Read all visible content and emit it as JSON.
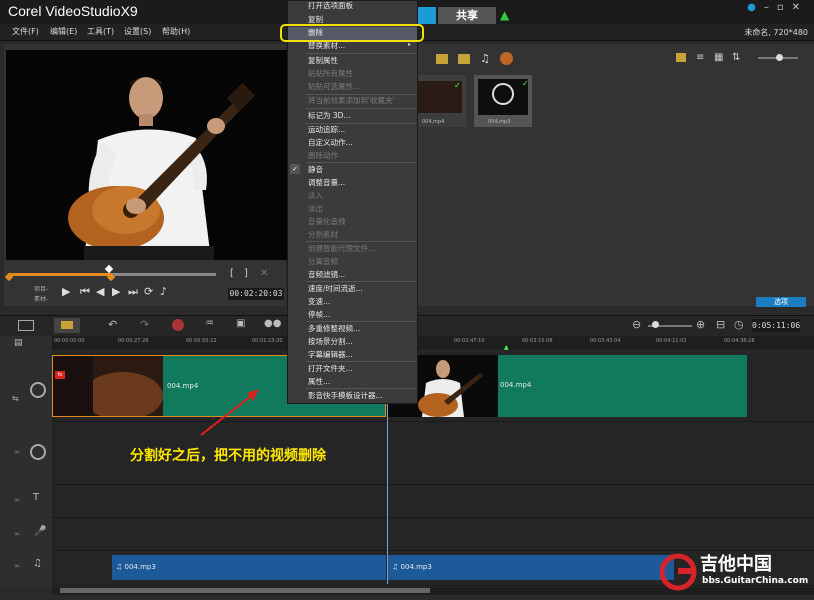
{
  "app": {
    "logo": "Corel VideoStudioX9",
    "share_tab": "共享",
    "project_info": "未命名, 720*480"
  },
  "menubar": {
    "items": [
      "文件(F)",
      "编辑(E)",
      "工具(T)",
      "设置(S)",
      "帮助(H)"
    ]
  },
  "preview": {
    "timecode": "00:02:20:03",
    "label_project": "项目-",
    "label_clip": "素材-"
  },
  "library": {
    "thumb1_label": "004.mp4",
    "thumb2_label": "004.mp3",
    "options_label": "选项"
  },
  "timeline": {
    "timecode": "0:05:11:06",
    "ruler_ticks": [
      "00:00:00:00",
      "00:00:27:26",
      "00:00:55:22",
      "00:01:23:20",
      "00:02:47:10",
      "00:03:15:08",
      "00:03:43:04",
      "00:04:11:02",
      "00:04:38:28"
    ],
    "video_clip1": "004.mp4",
    "video_clip2": "004.mp4",
    "audio_clip1": "004.mp3",
    "audio_clip2": "004.mp3"
  },
  "context_menu": {
    "items": [
      {
        "label": "打开选项面板",
        "disabled": false
      },
      {
        "label": "复制",
        "disabled": false
      },
      {
        "label": "删除",
        "disabled": false
      },
      {
        "label": "替换素材...",
        "disabled": false
      },
      {
        "label": "复制属性",
        "disabled": false
      },
      {
        "label": "粘贴所有属性",
        "disabled": true
      },
      {
        "label": "粘贴可选属性...",
        "disabled": true
      },
      {
        "label": "将当前效果添加到'收藏夹'",
        "disabled": true
      },
      {
        "label": "标记为 3D...",
        "disabled": false
      },
      {
        "label": "运动追踪...",
        "disabled": false
      },
      {
        "label": "自定义动作...",
        "disabled": false
      },
      {
        "label": "删除动作",
        "disabled": true
      },
      {
        "label": "静音",
        "disabled": false
      },
      {
        "label": "调整音量...",
        "disabled": false
      },
      {
        "label": "淡入",
        "disabled": true
      },
      {
        "label": "淡出",
        "disabled": true
      },
      {
        "label": "音量化音频",
        "disabled": true
      },
      {
        "label": "分割素材",
        "disabled": true
      },
      {
        "label": "创建智能代理文件...",
        "disabled": true
      },
      {
        "label": "分离音频",
        "disabled": true
      },
      {
        "label": "音频滤镜...",
        "disabled": false
      },
      {
        "label": "速度/时间流逝...",
        "disabled": false
      },
      {
        "label": "变速...",
        "disabled": false
      },
      {
        "label": "停帧...",
        "disabled": false
      },
      {
        "label": "多重修整视频...",
        "disabled": false
      },
      {
        "label": "按场景分割...",
        "disabled": false
      },
      {
        "label": "字幕编辑器...",
        "disabled": false
      },
      {
        "label": "打开文件夹...",
        "disabled": false
      },
      {
        "label": "属性...",
        "disabled": false
      },
      {
        "label": "影音快手模板设计器...",
        "disabled": false
      }
    ]
  },
  "annotation": "分割好之后，把不用的视频删除",
  "watermark": {
    "title": "吉他中国",
    "url": "bbs.GuitarChina.com"
  }
}
